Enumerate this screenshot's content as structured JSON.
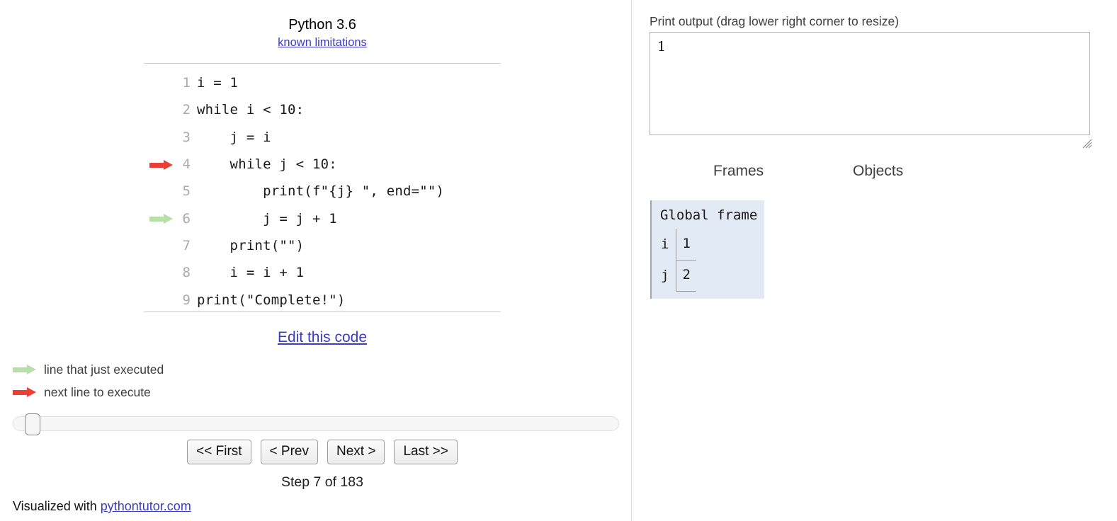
{
  "left": {
    "language_title": "Python 3.6",
    "known_limitations_label": "known limitations",
    "code_lines": [
      {
        "num": "1",
        "text": "i = 1",
        "marker": "none"
      },
      {
        "num": "2",
        "text": "while i < 10:",
        "marker": "none"
      },
      {
        "num": "3",
        "text": "    j = i",
        "marker": "none"
      },
      {
        "num": "4",
        "text": "    while j < 10:",
        "marker": "next"
      },
      {
        "num": "5",
        "text": "        print(f\"{j} \", end=\"\")",
        "marker": "none"
      },
      {
        "num": "6",
        "text": "        j = j + 1",
        "marker": "executed"
      },
      {
        "num": "7",
        "text": "    print(\"\")",
        "marker": "none"
      },
      {
        "num": "8",
        "text": "    i = i + 1",
        "marker": "none"
      },
      {
        "num": "9",
        "text": "print(\"Complete!\")",
        "marker": "none"
      }
    ],
    "edit_code_label": "Edit this code",
    "legend": {
      "executed_label": "line that just executed",
      "next_label": "next line to execute"
    },
    "nav": {
      "first_label": "<< First",
      "prev_label": "< Prev",
      "next_label": "Next >",
      "last_label": "Last >>"
    },
    "step_label": "Step 7 of 183",
    "footer": {
      "prefix": "Visualized with ",
      "link_label": "pythontutor.com"
    }
  },
  "right": {
    "print_output_label": "Print output (drag lower right corner to resize)",
    "print_output_value": "1",
    "columns": {
      "frames_label": "Frames",
      "objects_label": "Objects"
    },
    "global_frame": {
      "title": "Global frame",
      "variables": [
        {
          "name": "i",
          "value": "1"
        },
        {
          "name": "j",
          "value": "2"
        }
      ]
    }
  },
  "colors": {
    "next_arrow": "#e93f34",
    "executed_arrow": "#b6e0a8",
    "frame_background": "#e2eaf5",
    "link": "#3b3bc4"
  }
}
